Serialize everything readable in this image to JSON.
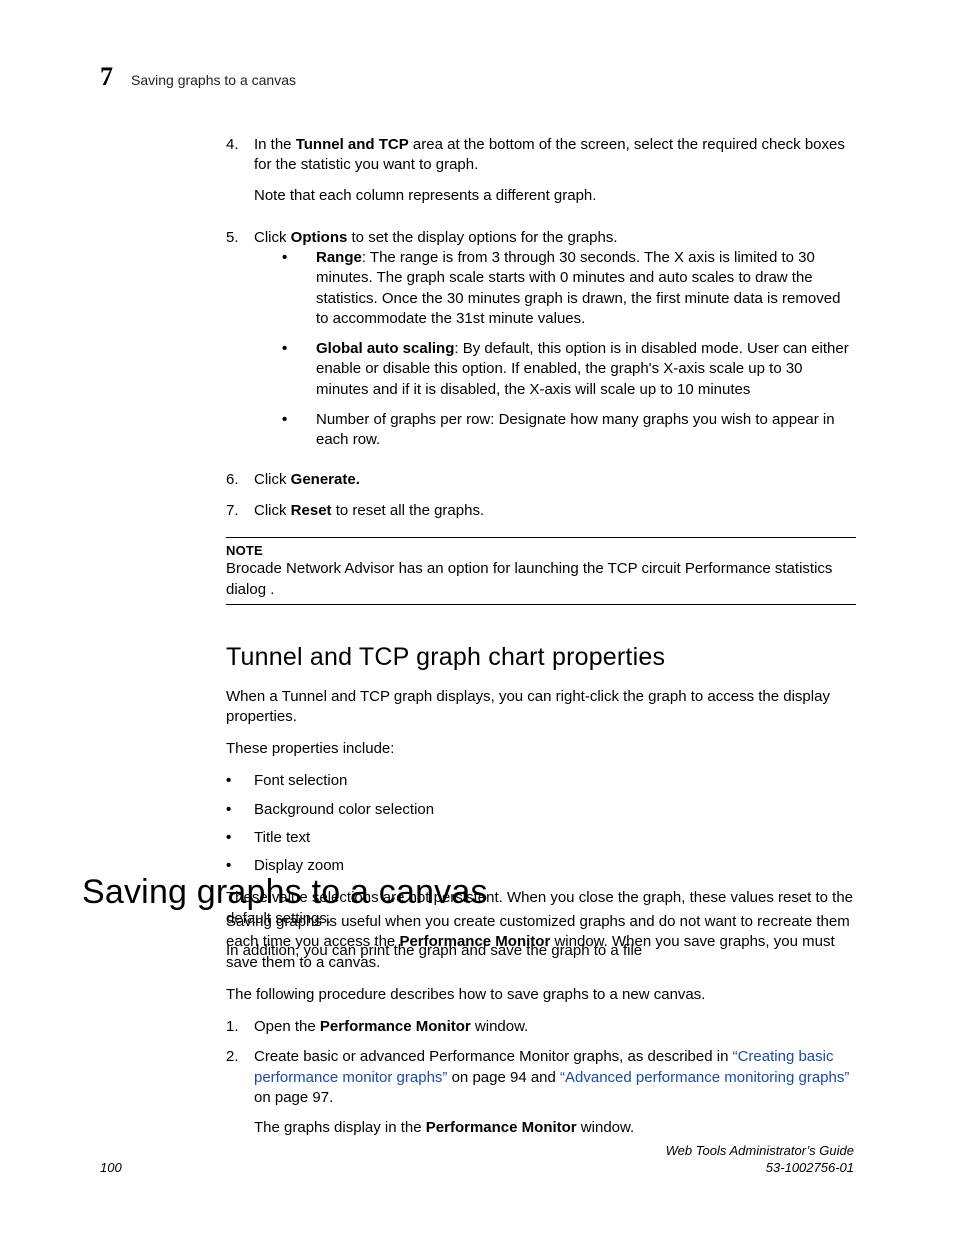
{
  "header": {
    "chapter_number": "7",
    "running_head": "Saving graphs to a canvas"
  },
  "steps_a": {
    "s4": {
      "n": "4.",
      "pre": "In the ",
      "bold": "Tunnel and TCP",
      "post": " area at the bottom of the screen, select the required check boxes for the statistic you want to graph.",
      "sub": "Note that each column represents a different graph."
    },
    "s5": {
      "n": "5.",
      "pre": "Click ",
      "bold": "Options",
      "post": " to set the display options for the graphs.",
      "bullets": {
        "b1": {
          "lead": "Range",
          "rest": ": The range is from 3 through 30 seconds. The X axis is limited to 30 minutes. The graph scale starts with 0 minutes and auto scales to draw the statistics. Once the 30 minutes graph is drawn, the first minute data is removed to accommodate the 31st minute values."
        },
        "b2": {
          "lead": "Global auto scaling",
          "rest": ": By default, this option is in disabled mode. User can either enable or disable this option. If enabled, the graph's X-axis scale up to 30 minutes and if it is disabled, the X-axis will scale up to 10 minutes"
        },
        "b3": {
          "text": "Number of graphs per row: Designate how many graphs you wish to appear in each row."
        }
      }
    },
    "s6": {
      "n": "6.",
      "pre": "Click ",
      "bold": "Generate."
    },
    "s7": {
      "n": "7.",
      "pre": "Click ",
      "bold": "Reset",
      "post": " to reset all the graphs."
    }
  },
  "note": {
    "label": "NOTE",
    "text": "Brocade Network Advisor has an option for launching the TCP circuit Performance statistics dialog ."
  },
  "h2": "Tunnel and TCP graph chart properties",
  "tcp_intro": "When a Tunnel and TCP graph displays, you can right-click the graph to access the display properties.",
  "tcp_lead": "These properties include:",
  "tcp_props": {
    "p1": "Font selection",
    "p2": "Background color selection",
    "p3": "Title text",
    "p4": "Display zoom"
  },
  "tcp_tail1": "These value selections are not persistent. When you close the graph, these values reset to the default settings.",
  "tcp_tail2": "In addition, you can print the graph and save the graph to a file",
  "h1": "Saving graphs to a canvas",
  "saving": {
    "p1_pre": "Saving graphs is useful when you create customized graphs and do not want to recreate them each time you access the ",
    "p1_bold": "Performance Monitor",
    "p1_post": " window. When you save graphs, you must save them to a canvas.",
    "p2": "The following procedure describes how to save graphs to a new canvas.",
    "s1": {
      "n": "1.",
      "pre": "Open the ",
      "bold": "Performance Monitor",
      "post": " window."
    },
    "s2": {
      "n": "2.",
      "pre": "Create basic or advanced Performance Monitor graphs, as described in ",
      "link1": "“Creating basic performance monitor graphs”",
      "mid1": " on page 94 and ",
      "link2": "“Advanced performance monitoring graphs”",
      "mid2": " on page 97.",
      "sub_pre": "The graphs display in the ",
      "sub_bold": "Performance Monitor",
      "sub_post": " window."
    }
  },
  "footer": {
    "page": "100",
    "title": "Web Tools Administrator’s Guide",
    "docnum": "53-1002756-01"
  }
}
